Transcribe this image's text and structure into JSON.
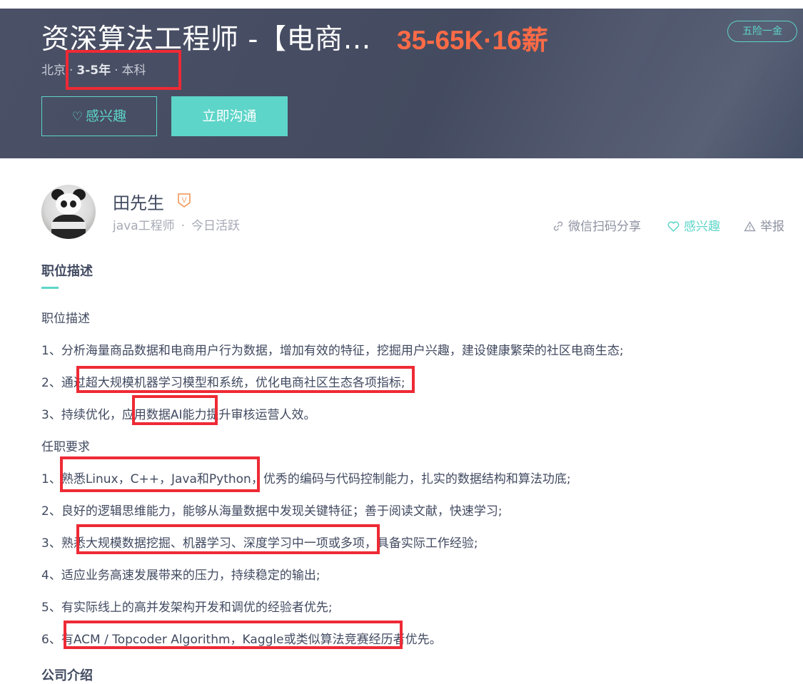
{
  "header": {
    "title": "资深算法工程师 -【电商…",
    "salary": "35-65K·16薪",
    "benefit_badge": "五险一金",
    "location": "北京",
    "separator": "·",
    "experience": "3-5年",
    "education": "本科",
    "interest_button": "感兴趣",
    "chat_button": "立即沟通"
  },
  "recruiter": {
    "name": "田先生",
    "verified_mark": "V",
    "role": "java工程师",
    "dot": "·",
    "activity": "今日活跃",
    "share_label": "微信扫码分享",
    "interest_label": "感兴趣",
    "report_label": "举报"
  },
  "description": {
    "section_title": "职位描述",
    "lines": [
      "职位描述",
      "1、分析海量商品数据和电商用户行为数据，增加有效的特征，挖掘用户兴趣，建设健康繁荣的社区电商生态;",
      "2、通过超大规模机器学习模型和系统，优化电商社区生态各项指标;",
      "3、持续优化，应用数据AI能力提升审核运营人效。",
      "任职要求",
      "1、熟悉Linux，C++，Java和Python，优秀的编码与代码控制能力，扎实的数据结构和算法功底;",
      "2、良好的逻辑思维能力，能够从海量数据中发现关键特征；善于阅读文献，快速学习;",
      "3、熟悉大规模数据挖掘、机器学习、深度学习中一项或多项，具备实际工作经验;",
      "4、适应业务高速发展带来的压力，持续稳定的输出;",
      "5、有实际线上的高并发架构开发和调优的经验者优先;",
      "6、有ACM / Topcoder Algorithm，Kaggle或类似算法竞赛经历者优先。"
    ],
    "next_section_title": "公司介绍"
  },
  "colors": {
    "banner": "#474e63",
    "accent": "#5dd5c8",
    "salary": "#ff6b46",
    "annotation": "#ee2a35"
  }
}
